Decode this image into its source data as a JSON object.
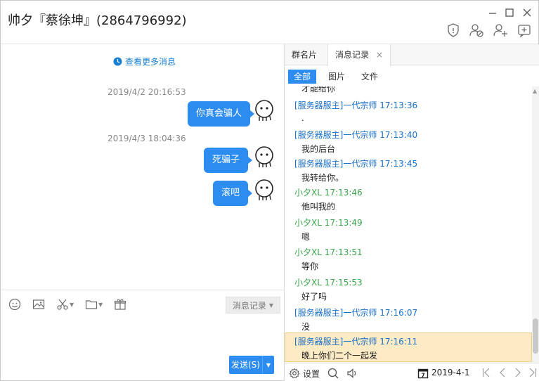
{
  "window": {
    "title": "帅夕『蔡徐坤』(2864796992)"
  },
  "chat": {
    "more_messages": "查看更多消息",
    "messages": [
      {
        "timestamp": "2019/4/2 20:16:53",
        "text": "你真会骗人"
      },
      {
        "timestamp": "2019/4/3 18:04:36",
        "text": "死骗子"
      },
      {
        "timestamp": "",
        "text": "滚吧"
      }
    ]
  },
  "toolbar": {
    "history_label": "消息记录"
  },
  "input": {
    "send_label": "发送(S)"
  },
  "right_panel": {
    "tabs": [
      {
        "label": "群名片"
      },
      {
        "label": "消息记录",
        "close": "×"
      }
    ],
    "subtabs": [
      "全部",
      "图片",
      "文件"
    ],
    "log_top_partial": "才能给你",
    "log": [
      {
        "sender": "[服务器服主]一代宗师",
        "time": "17:13:36",
        "text": ".",
        "color": "blue"
      },
      {
        "sender": "[服务器服主]一代宗师",
        "time": "17:13:40",
        "text": "我的后台",
        "color": "blue"
      },
      {
        "sender": "[服务器服主]一代宗师",
        "time": "17:13:45",
        "text": "我转给你。",
        "color": "blue"
      },
      {
        "sender": "小夕XL",
        "time": "17:13:46",
        "text": "他叫我的",
        "color": "green"
      },
      {
        "sender": "小夕XL",
        "time": "17:13:49",
        "text": "嗯",
        "color": "green"
      },
      {
        "sender": "小夕XL",
        "time": "17:13:51",
        "text": "等你",
        "color": "green"
      },
      {
        "sender": "小夕XL",
        "time": "17:15:53",
        "text": "好了吗",
        "color": "green"
      },
      {
        "sender": "[服务器服主]一代宗师",
        "time": "17:16:07",
        "text": "没",
        "color": "blue"
      },
      {
        "sender": "[服务器服主]一代宗师",
        "time": "17:16:11",
        "text": "晚上你们二个一起发",
        "color": "blue"
      }
    ],
    "footer": {
      "settings_label": "设置",
      "calendar_day": "7",
      "date": "2019-4-1"
    }
  },
  "colors": {
    "accent": "#2d8cf0",
    "sender_blue": "#1a6fc7",
    "sender_green": "#3aa54d",
    "highlight": "#fdebc6"
  }
}
